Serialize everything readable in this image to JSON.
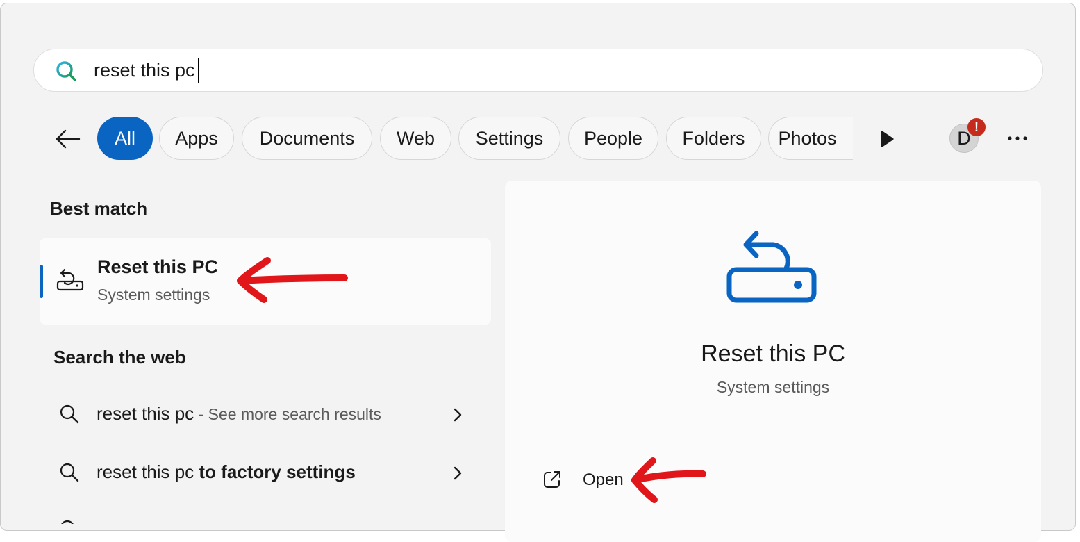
{
  "search": {
    "value": "reset this pc",
    "icon": "search-icon"
  },
  "filters": {
    "back_icon": "back-arrow-icon",
    "chips": [
      {
        "label": "All",
        "active": true
      },
      {
        "label": "Apps"
      },
      {
        "label": "Documents"
      },
      {
        "label": "Web"
      },
      {
        "label": "Settings"
      },
      {
        "label": "People"
      },
      {
        "label": "Folders"
      },
      {
        "label": "Photos"
      }
    ],
    "more_icon": "play-more-icon",
    "avatar_initial": "D",
    "avatar_badge": "!",
    "overflow_icon": "more-ellipsis-icon"
  },
  "best_match": {
    "heading": "Best match",
    "item": {
      "title": "Reset this PC",
      "subtitle": "System settings",
      "icon": "reset-pc-icon"
    }
  },
  "web": {
    "heading": "Search the web",
    "rows": [
      {
        "query": "reset this pc",
        "hint": "See more search results"
      },
      {
        "query_prefix": "reset this pc",
        "query_bold": "to factory settings"
      }
    ]
  },
  "detail": {
    "title": "Reset this PC",
    "subtitle": "System settings",
    "icon": "reset-pc-large-icon",
    "actions": [
      {
        "label": "Open",
        "icon": "open-external-icon"
      }
    ]
  },
  "colors": {
    "accent": "#0a64c2",
    "annotation": "#e0161a",
    "panel": "#f3f3f3"
  }
}
